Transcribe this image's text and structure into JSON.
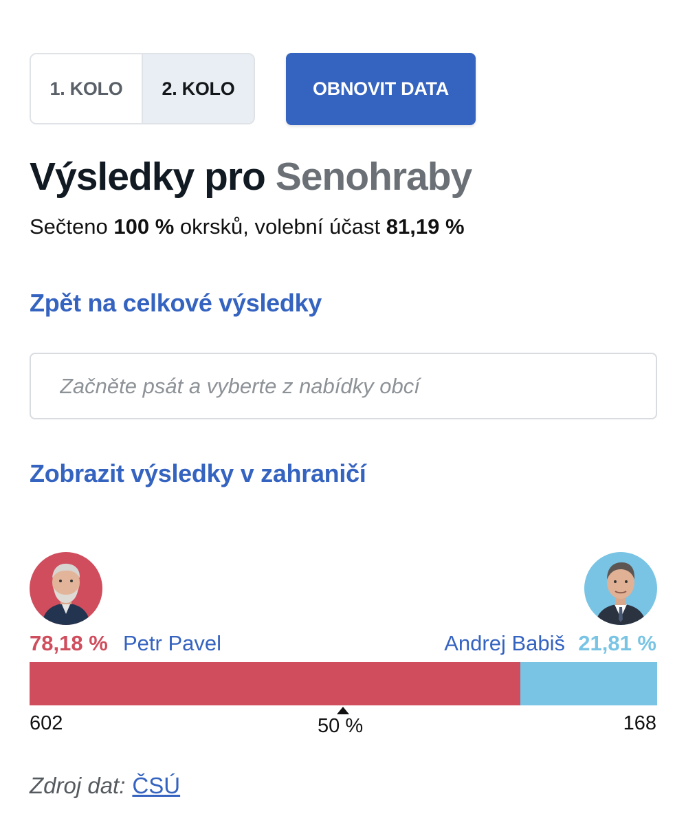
{
  "rounds": {
    "first_label": "1. KOLO",
    "second_label": "2. KOLO",
    "selected": "2. KOLO"
  },
  "refresh_button": {
    "label": "OBNOVIT DATA"
  },
  "header": {
    "title_prefix": "Výsledky pro",
    "place": "Senohraby"
  },
  "summary": {
    "counted_prefix": "Sečteno",
    "counted_value": "100 %",
    "counted_suffix": "okrsků, volební účast",
    "turnout_value": "81,19 %"
  },
  "links": {
    "back": "Zpět na celkové výsledky",
    "abroad": "Zobrazit výsledky v zahraničí"
  },
  "search": {
    "placeholder": "Začněte psát a vyberte z nabídky obcí",
    "value": ""
  },
  "candidates": [
    {
      "name": "Petr Pavel",
      "percent_label": "78,18 %",
      "percent": 78.18,
      "votes": "602",
      "color": "#cf4d5d",
      "avatar_icon": "pavel-portrait-icon"
    },
    {
      "name": "Andrej Babiš",
      "percent_label": "21,81 %",
      "percent": 21.81,
      "votes": "168",
      "color": "#79c4e4",
      "avatar_icon": "babis-portrait-icon"
    }
  ],
  "midpoint_label": "50 %",
  "source": {
    "label": "Zdroj dat:",
    "link": "ČSÚ"
  },
  "colors": {
    "accent": "#3563c0",
    "pavel": "#cf4d5d",
    "babis": "#79c4e4"
  }
}
